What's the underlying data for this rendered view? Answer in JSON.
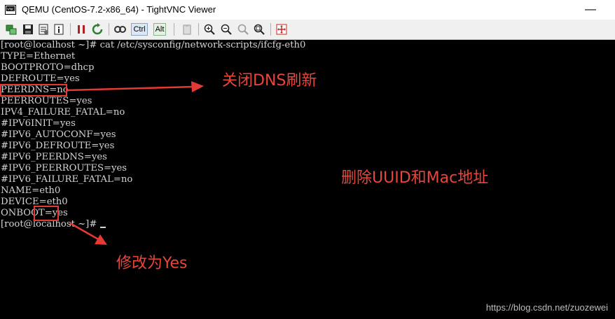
{
  "window": {
    "title": "QEMU (CentOS-7.2-x86_64) - TightVNC Viewer",
    "minimize_glyph": "—"
  },
  "toolbar": {
    "ctrl_label": "Ctrl",
    "alt_label": "Alt",
    "icons": [
      "new-connection-icon",
      "save-icon",
      "options-icon",
      "info-icon",
      "pause-icon",
      "refresh-icon",
      "keys-icon",
      "ctrl-key",
      "alt-key",
      "clipboard-icon",
      "zoom-in-icon",
      "zoom-out-icon",
      "zoom-100-icon",
      "zoom-fit-icon",
      "fullscreen-icon"
    ]
  },
  "terminal": {
    "lines": [
      "[root@localhost ~]# cat /etc/sysconfig/network-scripts/ifcfg-eth0",
      "TYPE=Ethernet",
      "BOOTPROTO=dhcp",
      "DEFROUTE=yes",
      "PEERDNS=no",
      "PEERROUTES=yes",
      "IPV4_FAILURE_FATAL=no",
      "#IPV6INIT=yes",
      "#IPV6_AUTOCONF=yes",
      "#IPV6_DEFROUTE=yes",
      "#IPV6_PEERDNS=yes",
      "#IPV6_PEERROUTES=yes",
      "#IPV6_FAILURE_FATAL=no",
      "NAME=eth0",
      "DEVICE=eth0",
      "ONBOOT=yes",
      "[root@localhost ~]# "
    ]
  },
  "annotations": {
    "dns": "关闭DNS刷新",
    "uuid": "删除UUID和Mac地址",
    "onboot": "修改为Yes"
  },
  "watermark": "https://blog.csdn.net/zuozewei",
  "colors": {
    "annotation": "#e8463a",
    "terminal_bg": "#000000",
    "terminal_fg": "#d4d4d4"
  }
}
